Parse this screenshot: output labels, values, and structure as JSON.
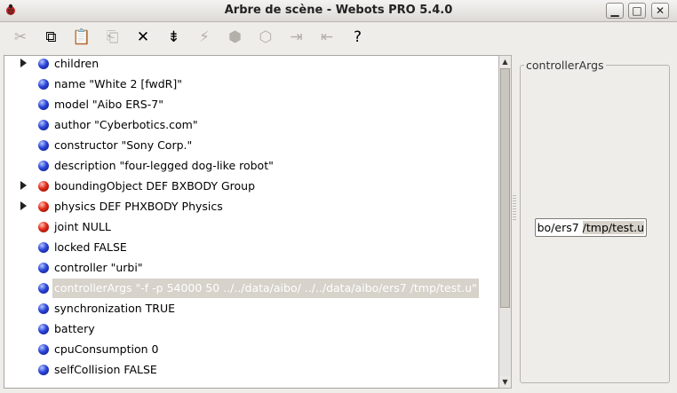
{
  "window": {
    "title": "Arbre de scène - Webots PRO 5.4.0",
    "buttons": {
      "minimize": "▁",
      "maximize": "□",
      "close": "✕"
    }
  },
  "toolbar": [
    {
      "name": "cut-icon",
      "glyph": "✂",
      "enabled": false
    },
    {
      "name": "copy-icon",
      "glyph": "⧉",
      "enabled": true
    },
    {
      "name": "paste-icon",
      "glyph": "📋",
      "enabled": false
    },
    {
      "name": "paste-after-icon",
      "glyph": "⎗",
      "enabled": false
    },
    {
      "name": "delete-icon",
      "glyph": "✕",
      "enabled": true
    },
    {
      "name": "collapse-icon",
      "glyph": "⇟",
      "enabled": true
    },
    {
      "name": "bolt-icon",
      "glyph": "⚡",
      "enabled": false
    },
    {
      "name": "node-insert-icon",
      "glyph": "⬢",
      "enabled": false
    },
    {
      "name": "node-edit-icon",
      "glyph": "⬡",
      "enabled": false
    },
    {
      "name": "import-icon",
      "glyph": "⇥",
      "enabled": false
    },
    {
      "name": "export-icon",
      "glyph": "⇤",
      "enabled": false
    },
    {
      "name": "help-icon",
      "glyph": "?",
      "enabled": true
    }
  ],
  "tree": {
    "rows": [
      {
        "label": "children",
        "ball": "blue",
        "expandable": true
      },
      {
        "label": "name \"White 2 [fwdR]\"",
        "ball": "blue",
        "expandable": false
      },
      {
        "label": "model \"Aibo ERS-7\"",
        "ball": "blue",
        "expandable": false
      },
      {
        "label": "author \"Cyberbotics.com\"",
        "ball": "blue",
        "expandable": false
      },
      {
        "label": "constructor \"Sony Corp.\"",
        "ball": "blue",
        "expandable": false
      },
      {
        "label": "description \"four-legged dog-like robot\"",
        "ball": "blue",
        "expandable": false
      },
      {
        "label": "boundingObject DEF BXBODY Group",
        "ball": "red",
        "expandable": true
      },
      {
        "label": "physics DEF PHXBODY Physics",
        "ball": "red",
        "expandable": true
      },
      {
        "label": "joint NULL",
        "ball": "red",
        "expandable": false
      },
      {
        "label": "locked FALSE",
        "ball": "blue",
        "expandable": false
      },
      {
        "label": "controller \"urbi\"",
        "ball": "blue",
        "expandable": false
      },
      {
        "label": "controllerArgs \"-f -p 54000 50 ../../data/aibo/ ../../data/aibo/ers7 /tmp/test.u\"",
        "ball": "blue",
        "expandable": false,
        "selected": true
      },
      {
        "label": "synchronization TRUE",
        "ball": "blue",
        "expandable": false
      },
      {
        "label": "battery",
        "ball": "blue",
        "expandable": false
      },
      {
        "label": "cpuConsumption 0",
        "ball": "blue",
        "expandable": false
      },
      {
        "label": "selfCollision FALSE",
        "ball": "blue",
        "expandable": false
      }
    ]
  },
  "scrollbar": {
    "up": "▲",
    "down": "▼"
  },
  "editor_panel": {
    "legend": "controllerArgs",
    "value_before": "bo/ers7 ",
    "value_selected": "/tmp/test.u"
  }
}
